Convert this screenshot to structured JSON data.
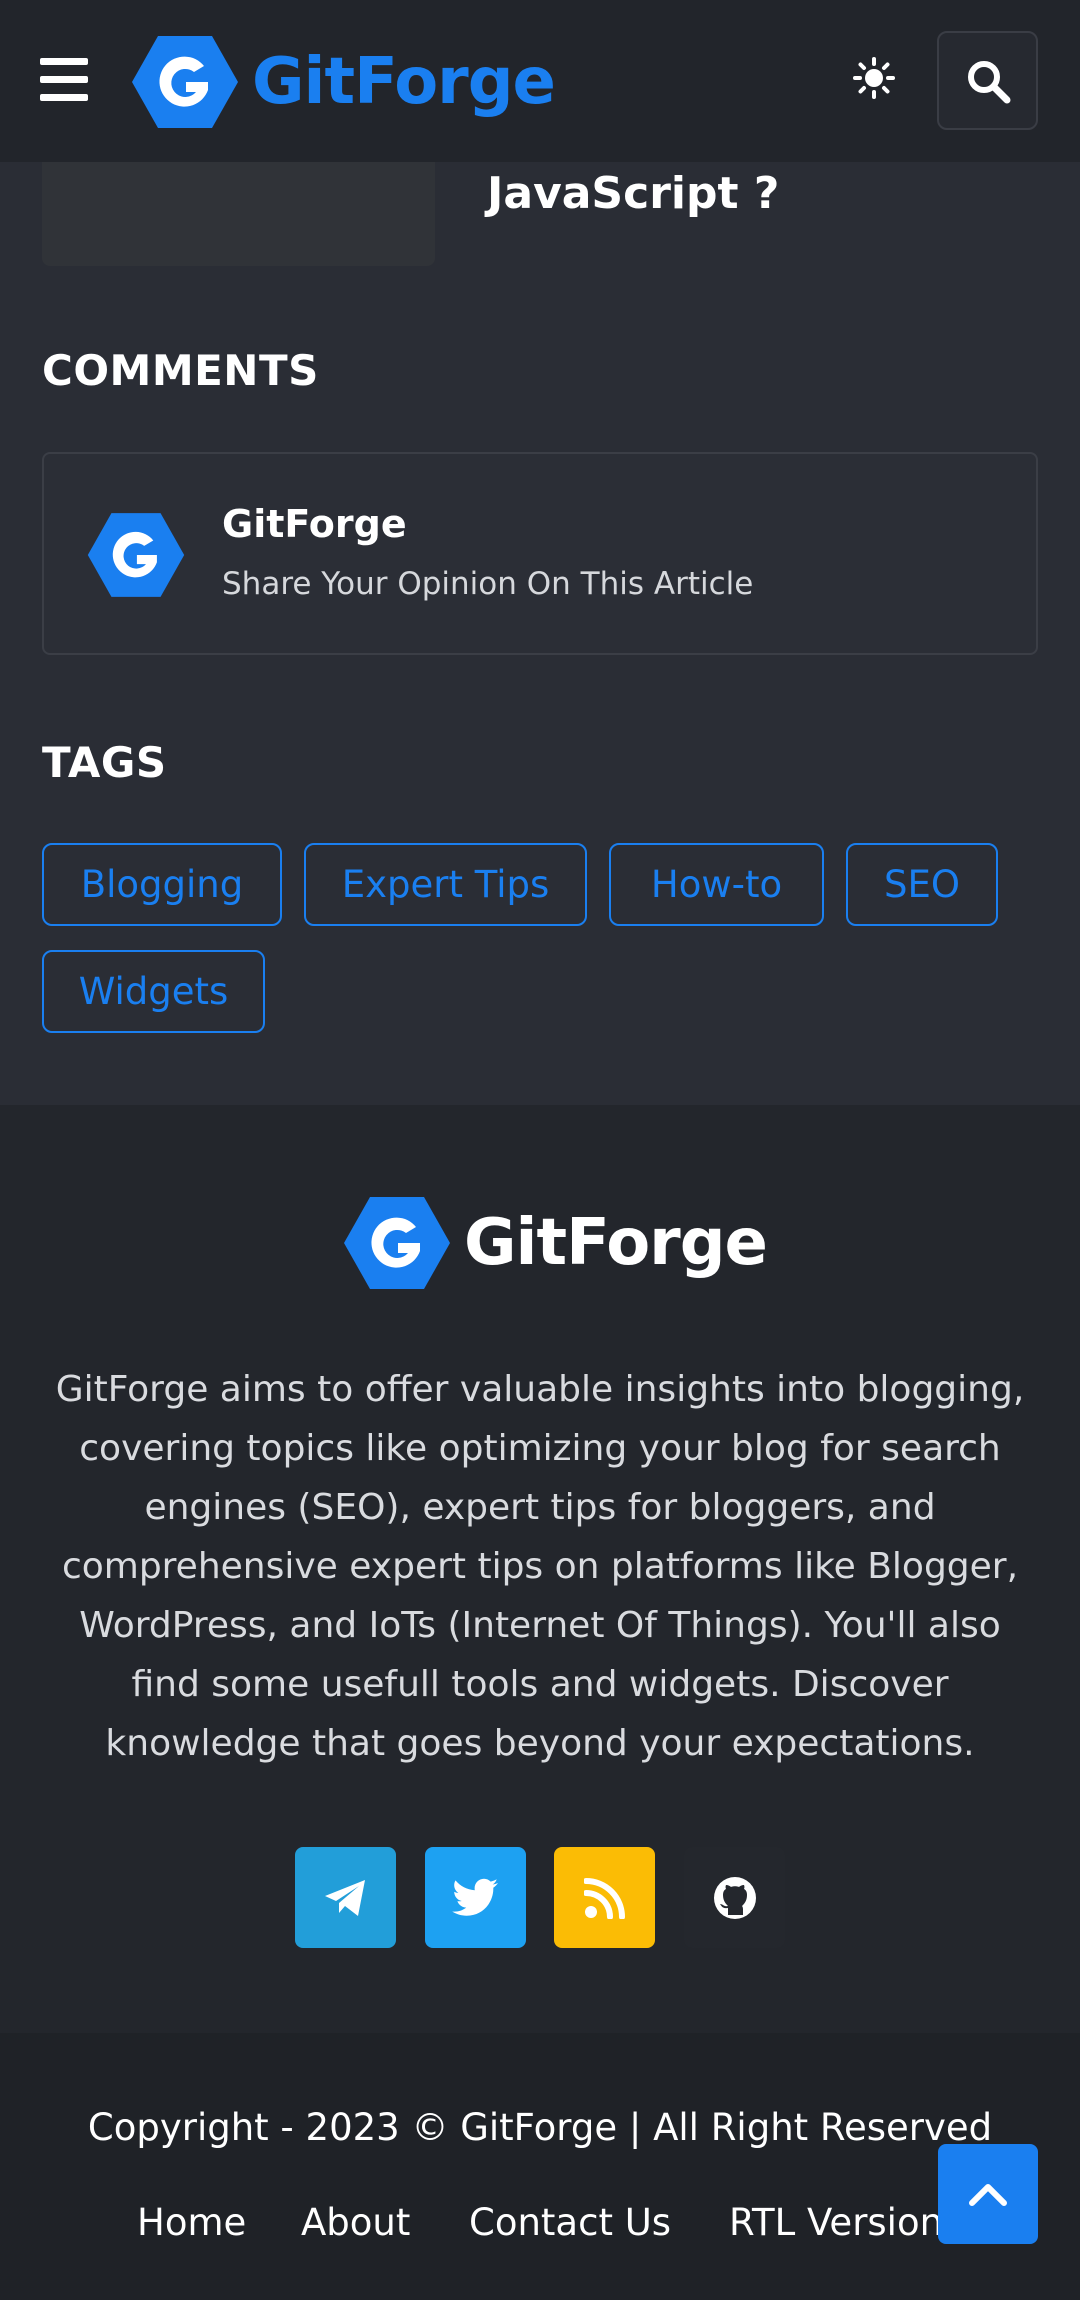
{
  "header": {
    "brand": "GitForge"
  },
  "article": {
    "title": "JavaScript ?"
  },
  "comments": {
    "heading": "COMMENTS",
    "name": "GitForge",
    "prompt": "Share Your Opinion On This Article"
  },
  "tags": {
    "heading": "TAGS",
    "items": [
      "Blogging",
      "Expert Tips",
      "How-to",
      "SEO",
      "Widgets"
    ]
  },
  "footer": {
    "brand": "GitForge",
    "description": "GitForge aims to offer valuable insights into blogging, covering topics like optimizing your blog for search engines (SEO), expert tips for bloggers, and comprehensive expert tips on platforms like Blogger, WordPress, and IoTs (Internet Of Things). You'll also find some usefull tools and widgets. Discover knowledge that goes beyond your expectations.",
    "social": [
      {
        "name": "telegram-icon",
        "color": "#229ed9"
      },
      {
        "name": "twitter-icon",
        "color": "#1da1f2"
      },
      {
        "name": "rss-icon",
        "color": "#fbbc05"
      },
      {
        "name": "github-icon",
        "color": "#24272d"
      }
    ],
    "copyright": "Copyright - 2023 © GitForge | All Right Reserved",
    "nav": [
      "Home",
      "About",
      "Contact Us",
      "RTL Version"
    ]
  },
  "colors": {
    "accent": "#1a7ff0",
    "background": "#2a2d35",
    "header": "#22252b"
  }
}
